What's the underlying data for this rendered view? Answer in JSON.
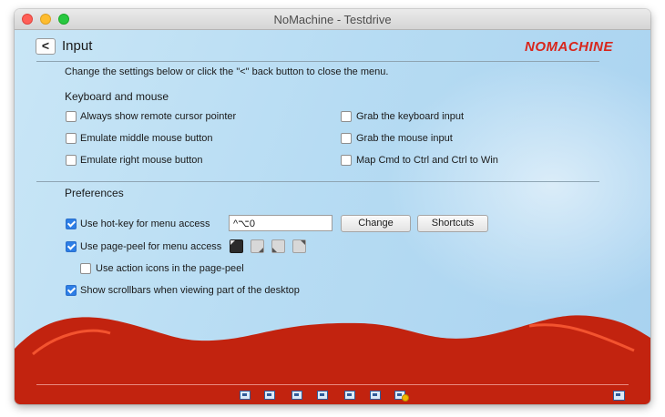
{
  "window": {
    "title": "NoMachine - Testdrive"
  },
  "header": {
    "back_label": "<",
    "title": "Input",
    "logo": "NOMACHINE"
  },
  "intro": "Change the settings below or click the \"<\" back button to close the menu.",
  "keyboard": {
    "heading": "Keyboard and mouse",
    "options": [
      {
        "label": "Always show remote cursor pointer",
        "checked": false
      },
      {
        "label": "Emulate middle mouse button",
        "checked": false
      },
      {
        "label": "Emulate right mouse button",
        "checked": false
      },
      {
        "label": "Grab the keyboard input",
        "checked": false
      },
      {
        "label": "Grab the mouse input",
        "checked": false
      },
      {
        "label": "Map Cmd to Ctrl and Ctrl to Win",
        "checked": false
      }
    ]
  },
  "preferences": {
    "heading": "Preferences",
    "hotkey": {
      "label": "Use hot-key for menu access",
      "checked": true,
      "value": "^⌥0",
      "change_label": "Change",
      "shortcuts_label": "Shortcuts"
    },
    "pagepeel": {
      "label": "Use page-peel for menu access",
      "checked": true,
      "corners": [
        "top-left",
        "bottom-right",
        "bottom-left",
        "top-right"
      ],
      "selected_corner": "top-left"
    },
    "action_icons": {
      "label": "Use action icons in the page-peel",
      "checked": false
    },
    "scrollbars": {
      "label": "Show scrollbars when viewing part of the desktop",
      "checked": true
    }
  },
  "toolbar": {
    "icons": [
      "display-fit-icon",
      "display-window-icon",
      "display-viewport-icon",
      "display-scale-icon",
      "fullscreen-icon",
      "resize-remote-icon",
      "display-settings-icon"
    ],
    "right_icon": "monitor-settings-icon"
  },
  "colors": {
    "accent": "#2d7ee6",
    "brand": "#d8261c",
    "wave": "#c2230f"
  }
}
